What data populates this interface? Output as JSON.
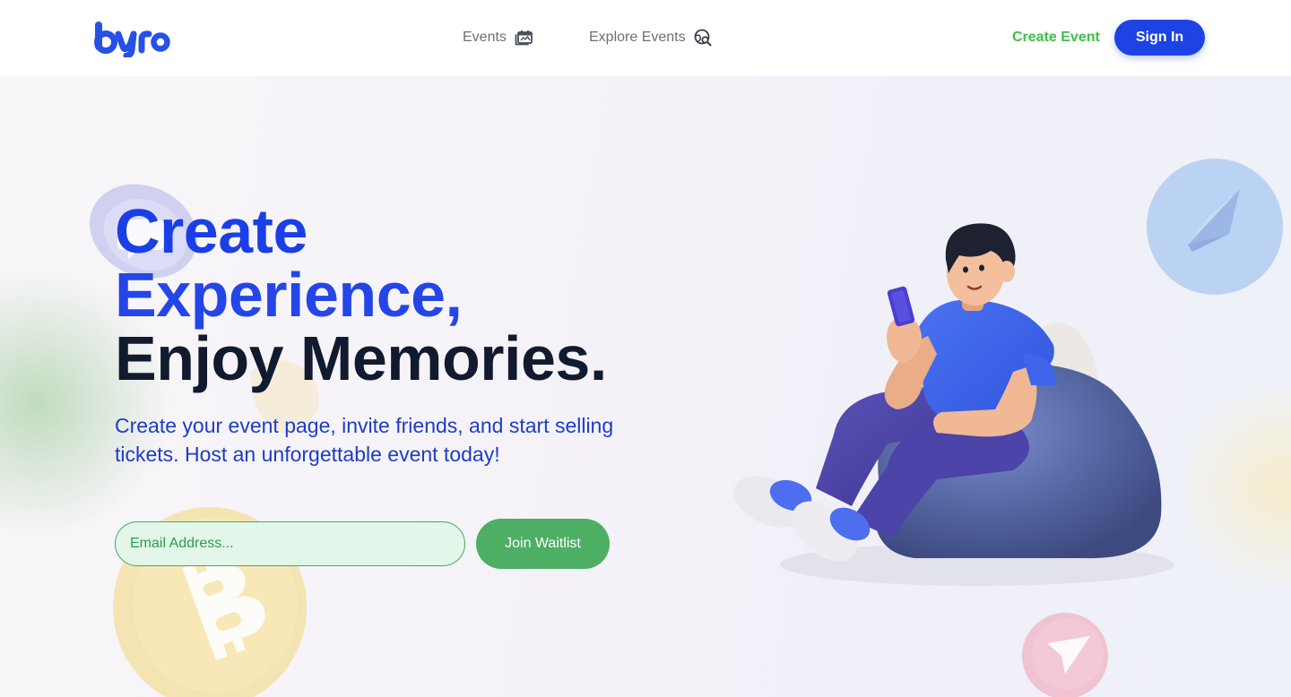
{
  "header": {
    "logo_text": "byro",
    "nav": [
      {
        "label": "Events",
        "icon": "calendar-gallery-icon"
      },
      {
        "label": "Explore Events",
        "icon": "globe-search-icon"
      }
    ],
    "create_event_label": "Create Event",
    "sign_in_label": "Sign In"
  },
  "hero": {
    "title_line1": "Create",
    "title_line2": "Experience,",
    "title_line3": "Enjoy Memories.",
    "subtitle": "Create your event page, invite friends, and start selling tickets. Host an unforgettable event today!",
    "email_placeholder": "Email Address...",
    "join_label": "Join Waitlist"
  },
  "colors": {
    "brand_blue": "#1d43e4",
    "accent_green": "#3fbf4c",
    "button_green": "#4caf64",
    "heading_dark": "#111a2e"
  },
  "decorations": [
    "chat-coin-icon",
    "bitcoin-coin-icon",
    "ethereum-coin-icon",
    "send-coin-icon",
    "person-on-beanbag-illustration"
  ]
}
